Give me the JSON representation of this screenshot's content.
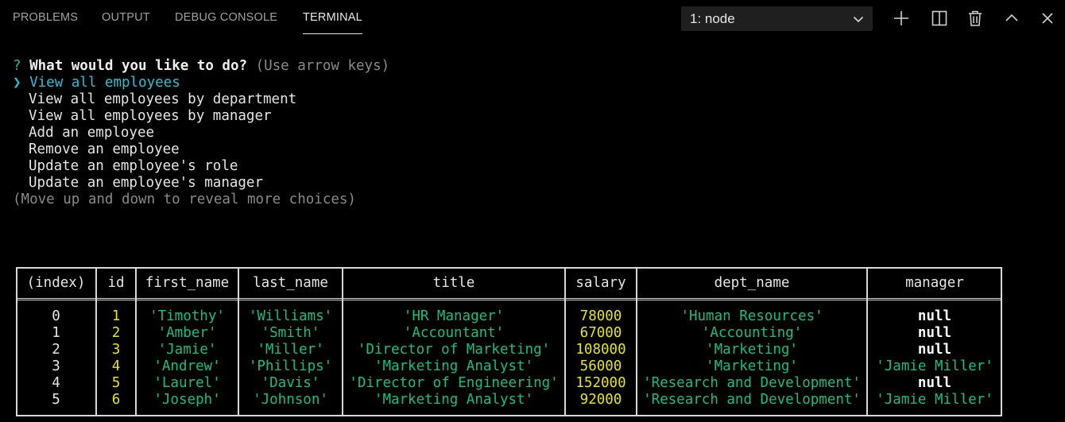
{
  "panel": {
    "tabs": [
      {
        "label": "PROBLEMS",
        "active": false
      },
      {
        "label": "OUTPUT",
        "active": false
      },
      {
        "label": "DEBUG CONSOLE",
        "active": false
      },
      {
        "label": "TERMINAL",
        "active": true
      }
    ],
    "terminal_select": {
      "value": "1: node"
    },
    "actions": [
      {
        "icon": "plus-icon"
      },
      {
        "icon": "split-icon"
      },
      {
        "icon": "trash-icon"
      },
      {
        "icon": "chevron-up-icon"
      },
      {
        "icon": "close-icon"
      }
    ]
  },
  "prompt": {
    "question_mark": "?",
    "question": "What would you like to do?",
    "hint": "(Use arrow keys)",
    "pointer": "❯",
    "choices": [
      "View all employees",
      "View all employees by department",
      "View all employees by manager",
      "Add an employee",
      "Remove an employee",
      "Update an employee's role",
      "Update an employee's manager"
    ],
    "selected_index": 0,
    "footer": "(Move up and down to reveal more choices)"
  },
  "table": {
    "headers": [
      "(index)",
      "id",
      "first_name",
      "last_name",
      "title",
      "salary",
      "dept_name",
      "manager"
    ],
    "rows": [
      [
        "0",
        "1",
        "'Timothy'",
        "'Williams'",
        "'HR Manager'",
        "78000",
        "'Human Resources'",
        "null"
      ],
      [
        "1",
        "2",
        "'Amber'",
        "'Smith'",
        "'Accountant'",
        "67000",
        "'Accounting'",
        "null"
      ],
      [
        "2",
        "3",
        "'Jamie'",
        "'Miller'",
        "'Director of Marketing'",
        "108000",
        "'Marketing'",
        "null"
      ],
      [
        "3",
        "4",
        "'Andrew'",
        "'Phillips'",
        "'Marketing Analyst'",
        "56000",
        "'Marketing'",
        "'Jamie Miller'"
      ],
      [
        "4",
        "5",
        "'Laurel'",
        "'Davis'",
        "'Director of Engineering'",
        "152000",
        "'Research and Development'",
        "null"
      ],
      [
        "5",
        "6",
        "'Joseph'",
        "'Johnson'",
        "'Marketing Analyst'",
        "92000",
        "'Research and Development'",
        "'Jamie Miller'"
      ]
    ]
  },
  "colors": {
    "background": "#000000",
    "prompt_selected": "#27c0d5",
    "number": "#e5e510",
    "string": "#11bf83",
    "text": "#e5e5e5"
  }
}
